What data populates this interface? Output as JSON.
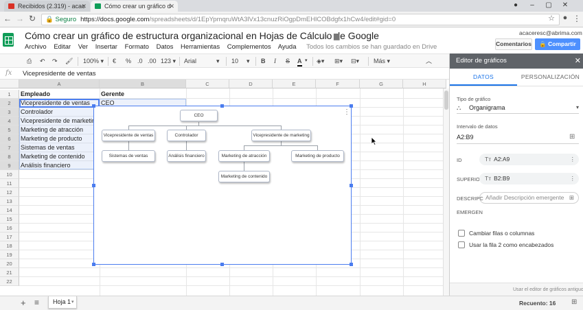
{
  "browser": {
    "tabs": [
      {
        "title": "Recibidos (2.319) - acac",
        "favicon": "gmail-icon",
        "color": "#d93025"
      },
      {
        "title": "Cómo crear un gráfico d",
        "favicon": "sheets-icon",
        "color": "#0f9d58"
      }
    ],
    "secure_label": "Seguro",
    "url_host": "https://docs.google.com",
    "url_path": "/spreadsheets/d/1EpYpmqruWtA3lVx13cnuzRiOgpDmEHlCOBdgfx1hCw4/edit#gid=0"
  },
  "document": {
    "title": "Cómo crear un gráfico de estructura organizacional en Hojas de Cálculo de Google",
    "menu": [
      "Archivo",
      "Editar",
      "Ver",
      "Insertar",
      "Formato",
      "Datos",
      "Herramientas",
      "Complementos",
      "Ayuda"
    ],
    "save_status": "Todos los cambios se han guardado en Drive",
    "account": "acaceresc@abrima.com",
    "comments_label": "Comentarios",
    "share_label": "Compartir"
  },
  "format_toolbar": {
    "zoom": "100%",
    "currency": "€",
    "percent": "%",
    "decrease_decimals": ".0",
    "increase_decimals": ".00",
    "number_format": "123",
    "font": "Arial",
    "font_size": "10",
    "more": "Más"
  },
  "formula_bar": {
    "fx": "fx",
    "value": "Vicepresidente de ventas"
  },
  "grid": {
    "columns": [
      "A",
      "B",
      "C",
      "D",
      "E",
      "F",
      "G",
      "H"
    ],
    "rows": [
      "1",
      "2",
      "3",
      "4",
      "5",
      "6",
      "7",
      "8",
      "9",
      "10",
      "11",
      "12",
      "13",
      "14",
      "15",
      "16",
      "17",
      "18",
      "19",
      "20",
      "21",
      "22"
    ],
    "header": {
      "a": "Empleado",
      "b": "Gerente"
    },
    "data": [
      {
        "a": "Vicepresidente de ventas",
        "b": "CEO"
      },
      {
        "a": "Controlador",
        "b": ""
      },
      {
        "a": "Vicepresidente de marketing",
        "b": ""
      },
      {
        "a": "Marketing de atracción",
        "b": ""
      },
      {
        "a": "Marketing de producto",
        "b": ""
      },
      {
        "a": "Sistemas de ventas",
        "b": ""
      },
      {
        "a": "Marketing de contenido",
        "b": ""
      },
      {
        "a": "Análisis financiero",
        "b": ""
      }
    ]
  },
  "org_chart": {
    "root": "CEO",
    "level1": [
      "Vicepresidente de ventas",
      "Controlador",
      "Vicepresidente de marketing"
    ],
    "level2": [
      "Sistemas de ventas",
      "Análisis financiero",
      "Marketing de atracción",
      "Marketing de producto"
    ],
    "level3": [
      "Marketing de contenido"
    ]
  },
  "sheets_bar": {
    "add": "+",
    "list": "≡",
    "sheet_name": "Hoja 1",
    "count": "Recuento: 16"
  },
  "chart_editor": {
    "title": "Editor de gráficos",
    "tabs": [
      "DATOS",
      "PERSONALIZACIÓN"
    ],
    "chart_type_label": "Tipo de gráfico",
    "chart_type": "Organigrama",
    "range_label": "Intervalo de datos",
    "range": "A2:B9",
    "id_label": "ID",
    "id_value": "A2:A9",
    "parent_label": "SUPERIOR",
    "parent_value": "B2:B9",
    "desc_label": "DESCRIPC",
    "desc_placeholder": "Añadir Descripción emergente",
    "emergent_label": "EMERGEN",
    "option1": "Cambiar filas o columnas",
    "option2": "Usar la fila 2 como encabezados",
    "footer": "Usar el editor de gráficos antiguo"
  }
}
